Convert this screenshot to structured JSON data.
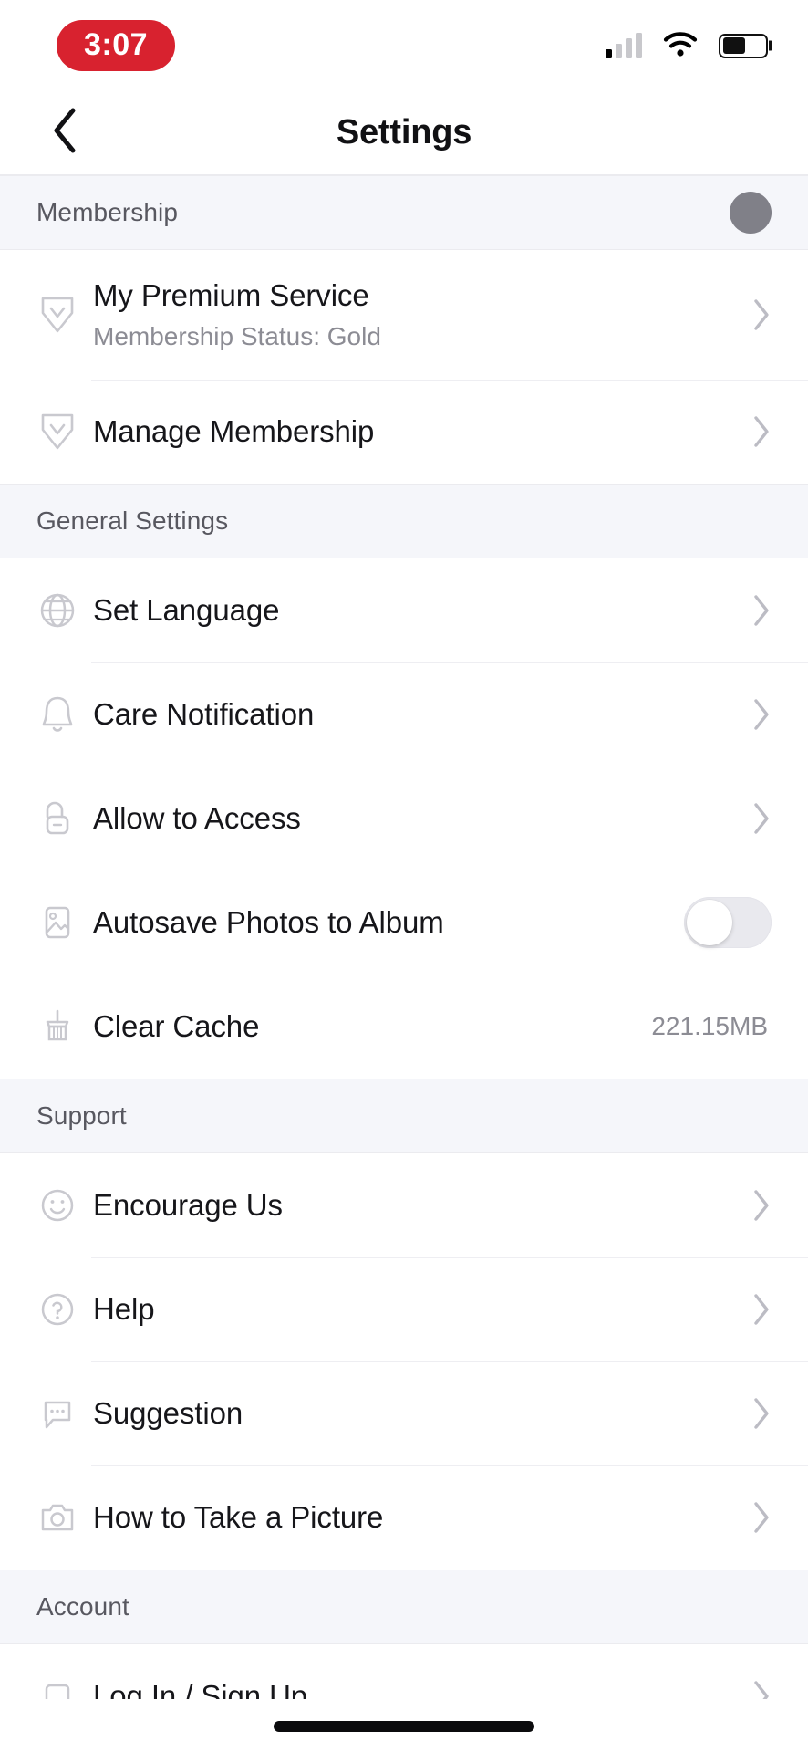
{
  "status_bar": {
    "time": "3:07",
    "signal_icon": "cellular-signal-icon",
    "wifi_icon": "wifi-icon",
    "battery_icon": "battery-icon",
    "battery_level_percent": 55
  },
  "nav": {
    "back_icon": "chevron-left-icon",
    "title": "Settings"
  },
  "sections": [
    {
      "key": "membership",
      "header": "Membership",
      "has_avatar": true,
      "rows": [
        {
          "icon": "shield-badge-icon",
          "title": "My Premium Service",
          "subtitle": "Membership Status: Gold",
          "accessory": "chevron"
        },
        {
          "icon": "shield-badge-icon",
          "title": "Manage Membership",
          "subtitle": "",
          "accessory": "chevron"
        }
      ]
    },
    {
      "key": "general",
      "header": "General Settings",
      "has_avatar": false,
      "rows": [
        {
          "icon": "globe-icon",
          "title": "Set Language",
          "subtitle": "",
          "accessory": "chevron"
        },
        {
          "icon": "bell-icon",
          "title": "Care Notification",
          "subtitle": "",
          "accessory": "chevron"
        },
        {
          "icon": "lock-icon",
          "title": "Allow to Access",
          "subtitle": "",
          "accessory": "chevron"
        },
        {
          "icon": "photo-image-icon",
          "title": "Autosave Photos to Album",
          "subtitle": "",
          "accessory": "toggle",
          "toggle_on": false
        },
        {
          "icon": "broom-icon",
          "title": "Clear Cache",
          "subtitle": "",
          "accessory": "value",
          "value": "221.15MB"
        }
      ]
    },
    {
      "key": "support",
      "header": "Support",
      "has_avatar": false,
      "rows": [
        {
          "icon": "smiley-face-icon",
          "title": "Encourage Us",
          "subtitle": "",
          "accessory": "chevron"
        },
        {
          "icon": "question-circle-icon",
          "title": "Help",
          "subtitle": "",
          "accessory": "chevron"
        },
        {
          "icon": "speech-bubble-icon",
          "title": "Suggestion",
          "subtitle": "",
          "accessory": "chevron"
        },
        {
          "icon": "camera-icon",
          "title": "How to Take a Picture",
          "subtitle": "",
          "accessory": "chevron"
        }
      ]
    },
    {
      "key": "account",
      "header": "Account",
      "has_avatar": false,
      "rows": [
        {
          "icon": "logout-icon",
          "title": "Log In / Sign Up",
          "subtitle": "",
          "accessory": "chevron"
        }
      ]
    }
  ],
  "colors": {
    "accent_red": "#d8222f",
    "section_bg": "#f5f6fa",
    "divider": "#eeeef2",
    "icon_gray": "#c3c3c9",
    "subtext_gray": "#8c8c94"
  }
}
